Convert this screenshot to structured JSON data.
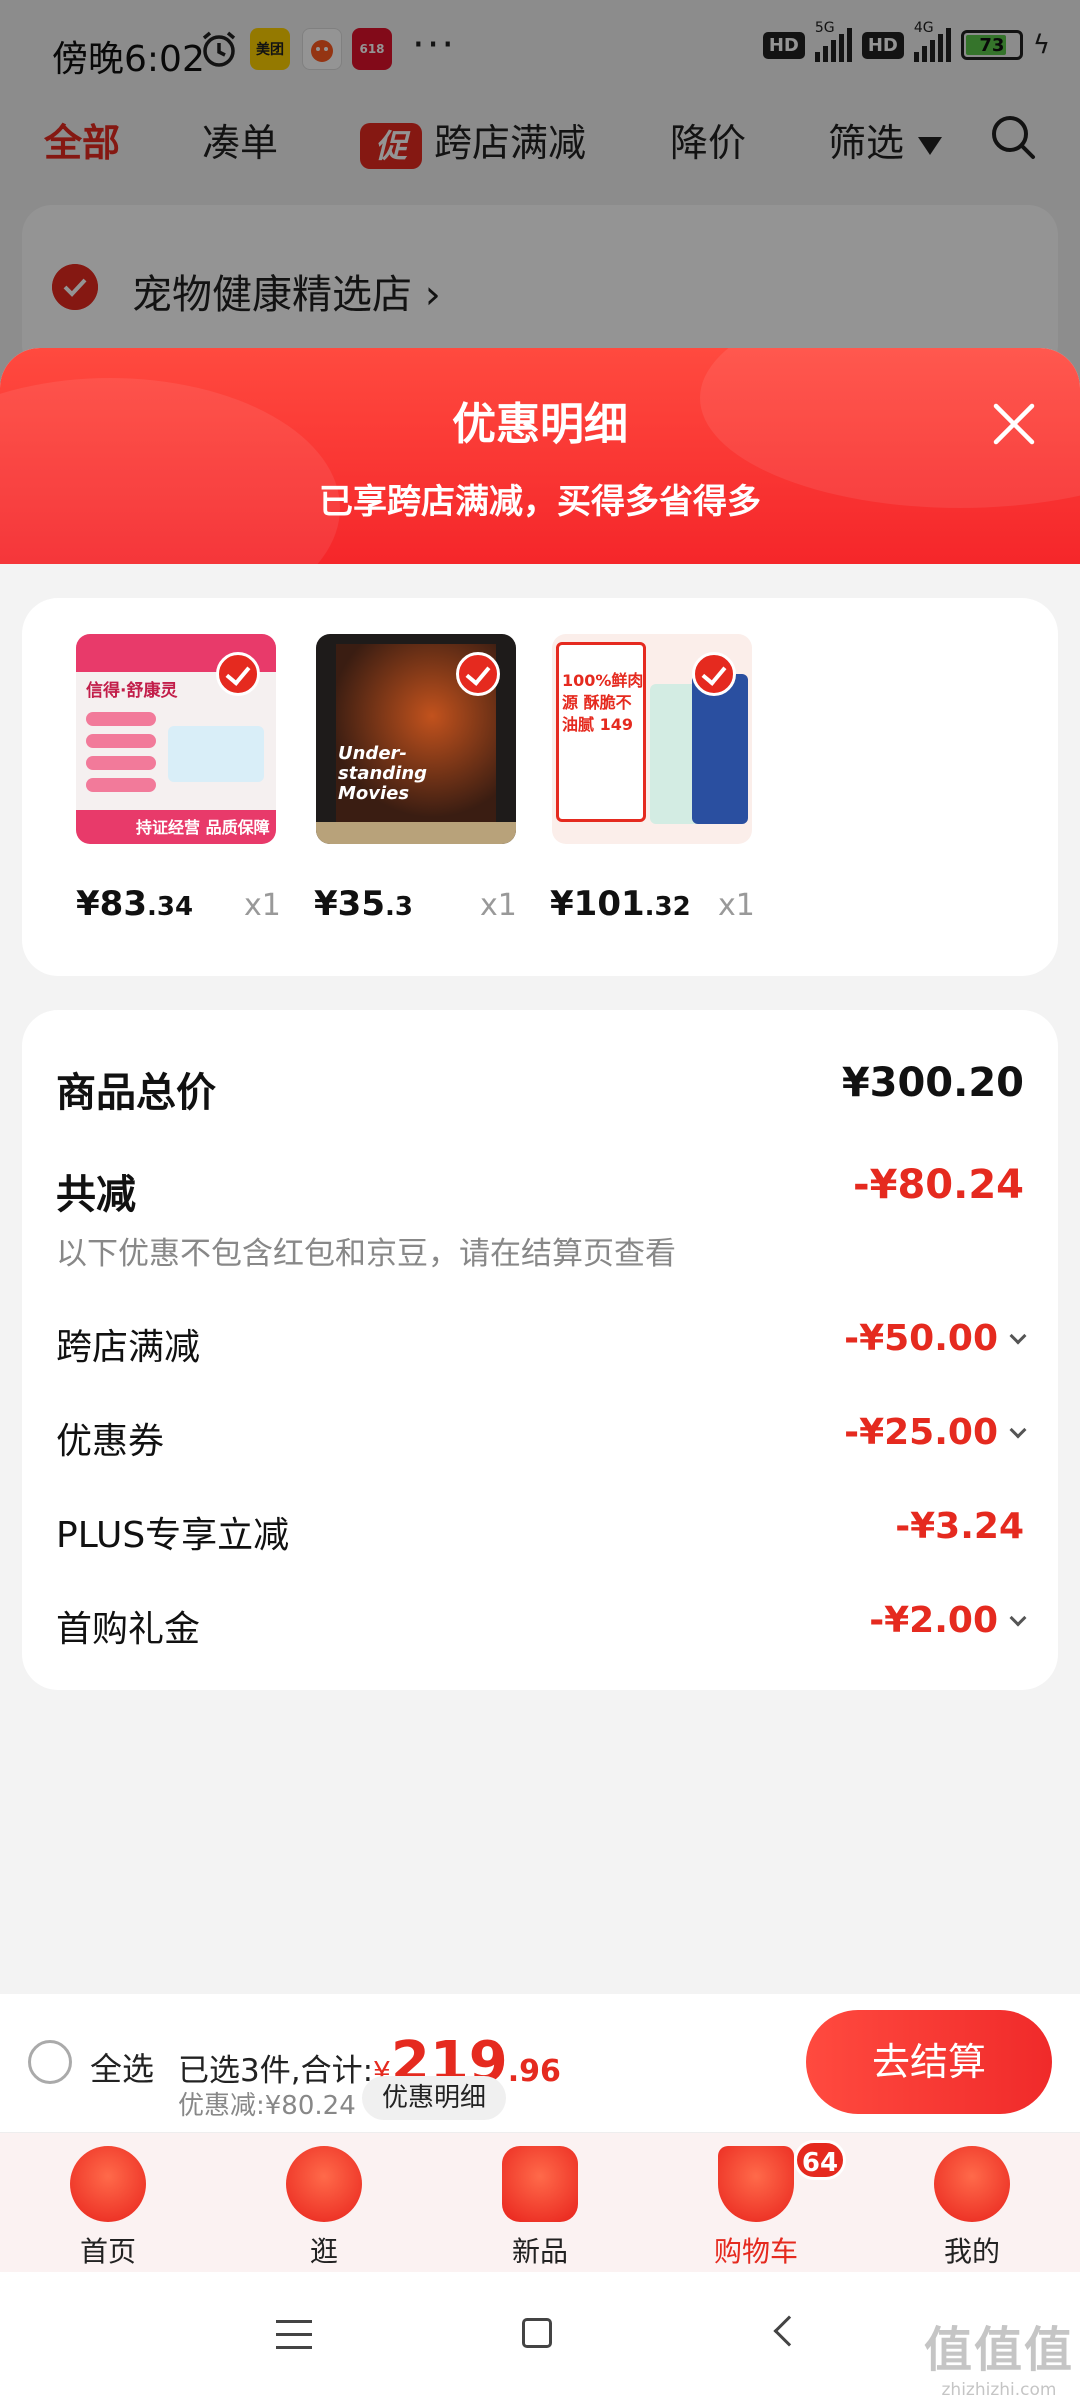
{
  "status_bar": {
    "time": "傍晚6:02",
    "app_badge_meituan": "美团",
    "app_badge_tmall_label": "618",
    "more": "···",
    "hd_1": "HD",
    "net_1": "5G",
    "hd_2": "HD",
    "net_2": "4G",
    "battery": "73"
  },
  "top_tabs": {
    "all": "全部",
    "bundle": "凑单",
    "promo_badge": "促",
    "cross_store": "跨店满减",
    "price_drop": "降价",
    "filter": "筛选"
  },
  "store": {
    "name": "宠物健康精选店",
    "chevron": "›"
  },
  "sheet": {
    "title": "优惠明细",
    "subtitle": "已享跨店满减，买得多省得多",
    "items": [
      {
        "price_int": "¥83",
        "price_dec": ".34",
        "qty": "x1",
        "thumb_caption": "信得·舒康灵",
        "thumb_tag": "持证经营 品质保障",
        "thumb_color": "#f5f0f0"
      },
      {
        "price_int": "¥35",
        "price_dec": ".3",
        "qty": "x1",
        "thumb_caption": "Under-standing Movies",
        "thumb_tag": "",
        "thumb_color": "#1e1b1a"
      },
      {
        "price_int": "¥101",
        "price_dec": ".32",
        "qty": "x1",
        "thumb_caption": "100%鲜肉源 酥脆不油腻 149",
        "thumb_tag": "",
        "thumb_color": "#fbeeea"
      }
    ],
    "total_label": "商品总价",
    "total_value": "¥300.20",
    "saved_label": "共减",
    "saved_value": "-¥80.24",
    "note": "以下优惠不包含红包和京豆，请在结算页查看",
    "discounts": [
      {
        "label": "跨店满减",
        "value": "-¥50.00",
        "expandable": true
      },
      {
        "label": "优惠券",
        "value": "-¥25.00",
        "expandable": true
      },
      {
        "label": "PLUS专享立减",
        "value": "-¥3.24",
        "expandable": false
      },
      {
        "label": "首购礼金",
        "value": "-¥2.00",
        "expandable": true
      }
    ]
  },
  "checkout": {
    "select_all": "全选",
    "selected_text": "已选3件,合计:",
    "currency": "¥",
    "total_int": "219",
    "total_dec": ".96",
    "discount_text": "优惠减:¥80.24",
    "detail_button": "优惠明细",
    "pay_button": "去结算"
  },
  "bottom_nav": {
    "items": [
      {
        "label": "首页",
        "icon": "home-icon"
      },
      {
        "label": "逛",
        "icon": "browse-icon"
      },
      {
        "label": "新品",
        "icon": "new-products-icon"
      },
      {
        "label": "购物车",
        "icon": "cart-icon",
        "badge": "64",
        "active": true
      },
      {
        "label": "我的",
        "icon": "profile-icon"
      }
    ]
  },
  "watermark": {
    "logo": "值值值",
    "url": "zhizhizhi.com"
  },
  "colors": {
    "accent": "#e52a1f",
    "header_gradient_top": "#ff4a3f",
    "header_gradient_bottom": "#f5262a"
  }
}
